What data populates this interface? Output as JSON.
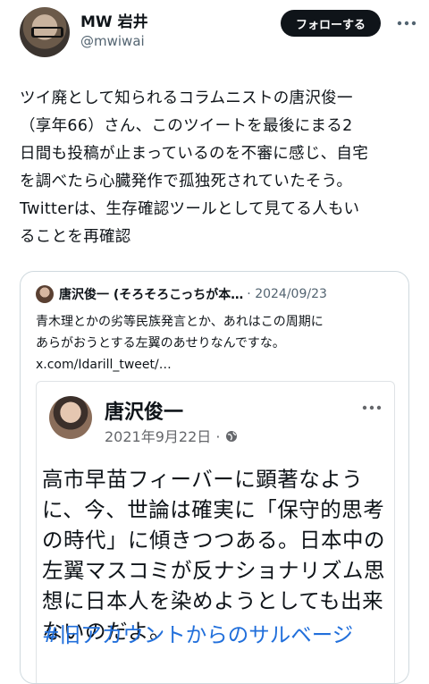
{
  "author": {
    "name": "MW 岩井",
    "handle": "@mwiwai",
    "follow_label": "フォローする",
    "more_icon": "ellipsis-icon"
  },
  "tweet": {
    "lines": [
      "ツイ廃として知られるコラムニストの唐沢俊一",
      "（享年66）さん、このツイートを最後にまる2",
      "日間も投稿が止まっているのを不審に感じ、自宅",
      "を調べたら心臓発作で孤独死されていたそう。",
      "Twitterは、生存確認ツールとして見てる人もい",
      "ることを再確認"
    ]
  },
  "quote": {
    "name": "唐沢俊一 (そろそろこっちが本…",
    "date": "· 2024/09/23",
    "lines": [
      "青木理とかの劣等民族発言とか、あれはこの周期に",
      "あらがおうとする左翼のあせりなんですな。",
      "x.com/Idarill_tweet/…"
    ]
  },
  "inner_post": {
    "name": "唐沢俊一",
    "date": "2021年9月22日 ·",
    "lines": [
      "高市早苗フィーバーに顕著なよう",
      "に、今、世論は確実に「保守的思考",
      "の時代」に傾きつつある。日本中の",
      "左翼マスコミが反ナショナリズム思",
      "想に日本人を染めようとしても出来",
      "ないのだよ。"
    ],
    "hashtag": "#旧アカウントからのサルベージ"
  },
  "colors": {
    "text": "#0f1419",
    "secondary": "#536471",
    "border": "#cfd9de",
    "button_bg": "#0f1419",
    "hashtag": "#216fdb"
  }
}
